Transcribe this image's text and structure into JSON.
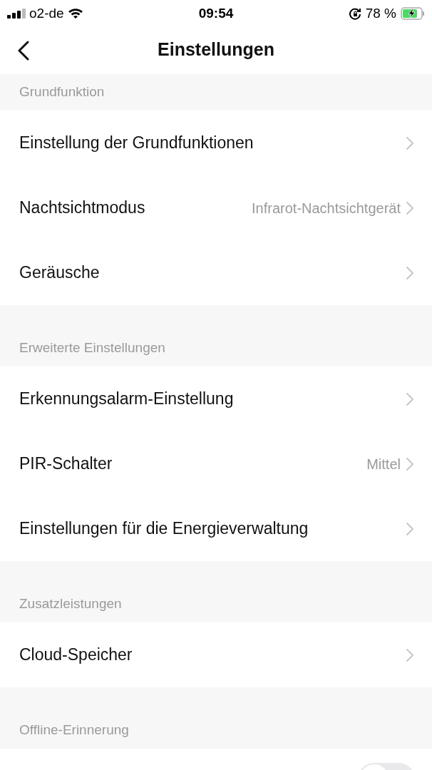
{
  "status_bar": {
    "carrier": "o2-de",
    "time": "09:54",
    "battery": "78 %"
  },
  "nav": {
    "title": "Einstellungen"
  },
  "sections": [
    {
      "title": "Grundfunktion",
      "rows": [
        {
          "kind": "link",
          "label": "Einstellung der Grundfunktionen"
        },
        {
          "kind": "link",
          "label": "Nachtsichtmodus",
          "value": "Infrarot-Nachtsichtgerät"
        },
        {
          "kind": "link",
          "label": "Geräusche"
        }
      ]
    },
    {
      "title": "Erweiterte Einstellungen",
      "rows": [
        {
          "kind": "link",
          "label": "Erkennungsalarm-Einstellung"
        },
        {
          "kind": "link",
          "label": "PIR-Schalter",
          "value": "Mittel"
        },
        {
          "kind": "link",
          "label": "Einstellungen für die Energieverwaltung"
        }
      ]
    },
    {
      "title": "Zusatzleistungen",
      "rows": [
        {
          "kind": "link",
          "label": "Cloud-Speicher"
        }
      ]
    },
    {
      "title": "Offline-Erinnerung",
      "rows": [
        {
          "kind": "toggle",
          "on": false
        }
      ]
    }
  ]
}
